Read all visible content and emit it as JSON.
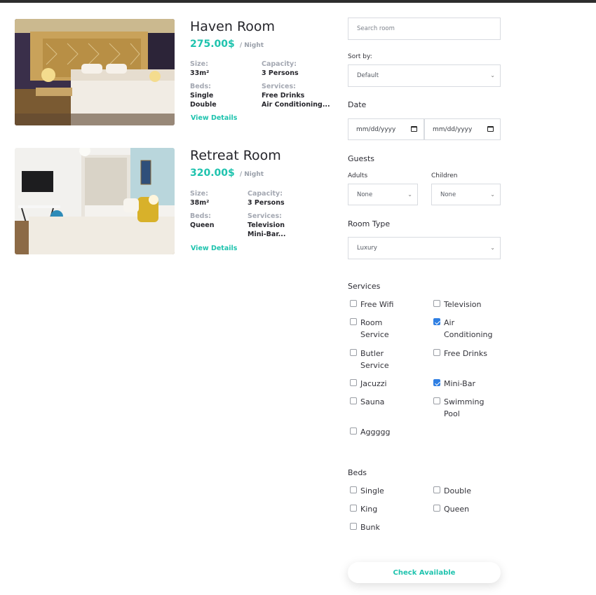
{
  "rooms": [
    {
      "title": "Haven Room",
      "price": "275.00$",
      "per_night": "/ Night",
      "size_label": "Size:",
      "size": "33m²",
      "capacity_label": "Capacity:",
      "capacity": "3 Persons",
      "beds_label": "Beds:",
      "beds": [
        "Single",
        "Double"
      ],
      "services_label": "Services:",
      "services": [
        "Free Drinks",
        "Air Conditioning..."
      ],
      "view_details": "View Details"
    },
    {
      "title": "Retreat Room",
      "price": "320.00$",
      "per_night": "/ Night",
      "size_label": "Size:",
      "size": "38m²",
      "capacity_label": "Capacity:",
      "capacity": "3 Persons",
      "beds_label": "Beds:",
      "beds": [
        "Queen"
      ],
      "services_label": "Services:",
      "services": [
        "Television",
        "Mini-Bar..."
      ],
      "view_details": "View Details"
    }
  ],
  "filters": {
    "search_placeholder": "Search room",
    "sort_label": "Sort by:",
    "sort_value": "Default",
    "date_title": "Date",
    "date_from": "mm/dd/yyyy",
    "date_to": "mm/dd/yyyy",
    "guests_title": "Guests",
    "adults_label": "Adults",
    "adults_value": "None",
    "children_label": "Children",
    "children_value": "None",
    "room_type_title": "Room Type",
    "room_type_value": "Luxury",
    "services_title": "Services",
    "services": [
      {
        "label": "Free Wifi",
        "checked": false
      },
      {
        "label": "Television",
        "checked": false
      },
      {
        "label": "Room Service",
        "checked": false
      },
      {
        "label": "Air Conditioning",
        "checked": true
      },
      {
        "label": "Butler Service",
        "checked": false
      },
      {
        "label": "Free Drinks",
        "checked": false
      },
      {
        "label": "Jacuzzi",
        "checked": false
      },
      {
        "label": "Mini-Bar",
        "checked": true
      },
      {
        "label": "Sauna",
        "checked": false
      },
      {
        "label": "Swimming Pool",
        "checked": false
      },
      {
        "label": "Aggggg",
        "checked": false
      }
    ],
    "beds_title": "Beds",
    "beds": [
      {
        "label": "Single",
        "checked": false
      },
      {
        "label": "Double",
        "checked": false
      },
      {
        "label": "King",
        "checked": false
      },
      {
        "label": "Queen",
        "checked": false
      },
      {
        "label": "Bunk",
        "checked": false
      }
    ],
    "check_button": "Check Available"
  },
  "colors": {
    "accent": "#1fc3ae",
    "checkbox_checked": "#2f7fe3",
    "top_bar": "#2d2d2d"
  }
}
